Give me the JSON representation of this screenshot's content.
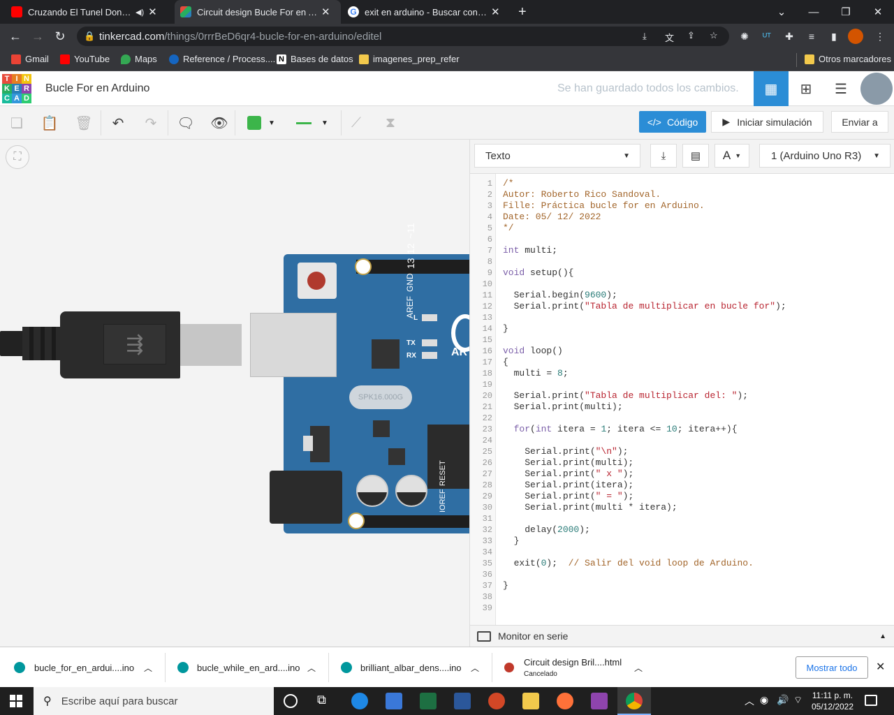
{
  "browser": {
    "tabs": [
      {
        "title": "Cruzando El Tunel Donde Se",
        "favicon": "youtube-icon"
      },
      {
        "title": "Circuit design Bucle For en Ardui",
        "favicon": "tinkercad-icon"
      },
      {
        "title": "exit en arduino - Buscar con Goo",
        "favicon": "google-icon"
      }
    ],
    "new_tab": "+",
    "url_domain": "tinkercad.com",
    "url_path": "/things/0rrrBeD6qr4-bucle-for-en-arduino/editel",
    "bookmarks": [
      {
        "label": "Gmail",
        "icon": "gmail-icon",
        "color": "#ea4335"
      },
      {
        "label": "YouTube",
        "icon": "youtube-icon",
        "color": "#ff0000"
      },
      {
        "label": "Maps",
        "icon": "maps-icon",
        "color": "#34a853"
      },
      {
        "label": "Reference / Process....",
        "icon": "processing-icon",
        "color": "#1565c0"
      },
      {
        "label": "Bases de datos",
        "icon": "notion-icon",
        "color": "#ffffff"
      },
      {
        "label": "imagenes_prep_refer",
        "icon": "folder-icon",
        "color": "#f2c94c"
      }
    ],
    "other_bookmarks": "Otros marcadores"
  },
  "app": {
    "logo_letters": [
      "T",
      "I",
      "N",
      "K",
      "E",
      "R",
      "C",
      "A",
      "D"
    ],
    "logo_colors": [
      "#e74c3c",
      "#e67e22",
      "#f1c40f",
      "#27ae60",
      "#2980b9",
      "#8e44ad",
      "#1abc9c",
      "#3498db",
      "#2ecc71"
    ],
    "project_title": "Bucle For en Arduino",
    "save_status": "Se han guardado todos los cambios.",
    "accent": "#2b8dd6"
  },
  "toolbar": {
    "code_label": "Código",
    "simulate_label": "Iniciar simulación",
    "send_label": "Enviar a",
    "fill_color": "#3cb54a",
    "wire_color": "#3cb54a"
  },
  "board": {
    "pin_labels": [
      "AREF",
      "GND",
      "13",
      "12",
      "~11"
    ],
    "led_labels": [
      "L",
      "TX",
      "RX"
    ],
    "power_labels": [
      "IOREF",
      "RESET"
    ],
    "crystal": "SPK16.000G",
    "brand_partial": "AR"
  },
  "code_panel": {
    "mode": "Texto",
    "device": "1 (Arduino Uno R3)",
    "line_numbers": [
      "1",
      "2",
      "3",
      "4",
      "5",
      "6",
      "7",
      "8",
      "9",
      "10",
      "11",
      "12",
      "13",
      "14",
      "15",
      "16",
      "17",
      "18",
      "19",
      "20",
      "21",
      "22",
      "23",
      "24",
      "25",
      "26",
      "27",
      "28",
      "29",
      "30",
      "31",
      "32",
      "33",
      "34",
      "35",
      "36",
      "37",
      "38",
      "39"
    ],
    "serial_monitor": "Monitor en serie"
  },
  "code": {
    "l1": "/*",
    "l2": "Autor: Roberto Rico Sandoval.",
    "l3": "Fille: Práctica bucle for en Arduino.",
    "l4": "Date: 05/ 12/ 2022",
    "l5": "*/",
    "l7_kw": "int",
    "l7_rest": " multi;",
    "l9_kw": "void",
    "l9_rest": " setup(){",
    "l11_a": "  Serial.begin(",
    "l11_n": "9600",
    "l11_b": ");",
    "l12_a": "  Serial.print(",
    "l12_s": "\"Tabla de multiplicar en bucle for\"",
    "l12_b": ");",
    "l14": "}",
    "l16_kw": "void",
    "l16_rest": " loop()",
    "l17": "{",
    "l18_a": "  multi = ",
    "l18_n": "8",
    "l18_b": ";",
    "l20_a": "  Serial.print(",
    "l20_s": "\"Tabla de multiplicar del: \"",
    "l20_b": ");",
    "l21": "  Serial.print(multi);",
    "l23_kw": "  for",
    "l23_a": "(",
    "l23_kw2": "int",
    "l23_b": " itera = ",
    "l23_n1": "1",
    "l23_c": "; itera <= ",
    "l23_n2": "10",
    "l23_d": "; itera++){",
    "l25_a": "    Serial.print(",
    "l25_s": "\"\\n\"",
    "l25_b": ");",
    "l26": "    Serial.print(multi);",
    "l27_a": "    Serial.print(",
    "l27_s": "\" x \"",
    "l27_b": ");",
    "l28": "    Serial.print(itera);",
    "l29_a": "    Serial.print(",
    "l29_s": "\" = \"",
    "l29_b": ");",
    "l30": "    Serial.print(multi * itera);",
    "l32_a": "    delay(",
    "l32_n": "2000",
    "l32_b": ");",
    "l33": "  }",
    "l35_a": "  exit(",
    "l35_n": "0",
    "l35_b": ");  ",
    "l35_c": "// Salir del void loop de Arduino.",
    "l37": "}"
  },
  "downloads": {
    "items": [
      {
        "name": "bucle_for_en_ardui....ino",
        "status": ""
      },
      {
        "name": "bucle_while_en_ard....ino",
        "status": ""
      },
      {
        "name": "brilliant_albar_dens....ino",
        "status": ""
      },
      {
        "name": "Circuit design Bril....html",
        "status": "Cancelado"
      }
    ],
    "show_all": "Mostrar todo"
  },
  "taskbar": {
    "search_placeholder": "Escribe aquí para buscar",
    "time": "11:11 p. m.",
    "date": "05/12/2022"
  }
}
